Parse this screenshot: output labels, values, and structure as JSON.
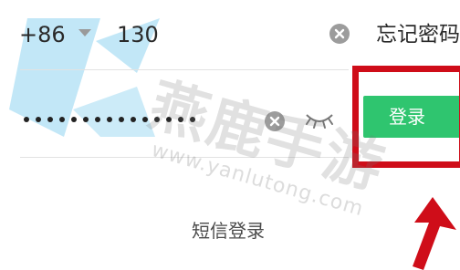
{
  "login_form": {
    "country_code": "+86",
    "phone_value": "130",
    "forgot_password": "忘记密码",
    "password_mask": "•••••••••••••••",
    "login_button": "登录",
    "sms_login": "短信登录"
  },
  "watermark": {
    "brand": "燕鹿手游",
    "url": "www.yanlutong.com"
  },
  "colors": {
    "login_button": "#2fc56f",
    "highlight": "#cf0d19",
    "watermark_logo": "#8fd3f0"
  },
  "icons": [
    "chevron-down-icon",
    "clear-icon",
    "eye-closed-icon",
    "arrow-up-icon"
  ]
}
